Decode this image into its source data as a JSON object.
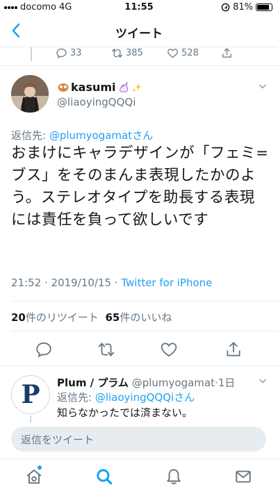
{
  "status": {
    "carrier": "docomo",
    "network": "4G",
    "time": "11:55",
    "battery": "81%"
  },
  "nav": {
    "title": "ツイート"
  },
  "prev_tweet": {
    "replies": "33",
    "retweets": "385",
    "likes": "528"
  },
  "tweet": {
    "name": "kasumi",
    "handle": "@liaoyingQQQi",
    "reply_prefix": "返信先: ",
    "reply_handle": "@plumyogamat",
    "reply_suffix": "さん",
    "text": "おまけにキャラデザインが「フェミ=ブス」をそのまんま表現したかのよう。ステレオタイプを助長する表現には責任を負って欲しいです",
    "time": "21:52",
    "date": "2019/10/15",
    "source": "Twitter for iPhone",
    "retweet_count": "20",
    "retweet_label": "件のリツイート",
    "like_count": "65",
    "like_label": "件のいいね"
  },
  "reply": {
    "avatar_letter": "P",
    "name": "Plum / プラム",
    "handle": "@plumyogamat",
    "time": "1日",
    "reply_prefix": "返信先: ",
    "reply_handle": "@liaoyingQQQi",
    "reply_suffix": "さん",
    "text": "知らなかったでは済まない。"
  },
  "compose": {
    "placeholder": "返信をツイート"
  },
  "colors": {
    "accent": "#1da1f2",
    "secondary_text": "#657786",
    "border": "#e6ecf0"
  },
  "icons": {
    "status": [
      "signal-icon",
      "location-icon",
      "battery-icon"
    ],
    "actions": [
      "reply-icon",
      "retweet-icon",
      "like-icon",
      "share-icon"
    ],
    "tabbar": [
      "home-icon",
      "search-icon",
      "notifications-icon",
      "messages-icon"
    ]
  }
}
